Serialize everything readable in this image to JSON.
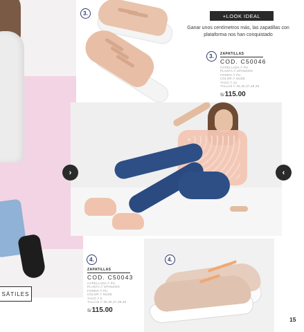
{
  "header": {
    "tag": "+LOOK IDEAL",
    "intro": "Ganar unos centímetros más, las zapatillas con plataforma nos han conquistado"
  },
  "left_label": "SÁTILES",
  "badges": {
    "shoe3_photo": "3.",
    "shoe3_info": "3.",
    "shoe4_photo": "4.",
    "shoe4_info": "4."
  },
  "nav": {
    "next_icon": "›",
    "prev_icon": "‹"
  },
  "products": [
    {
      "category": "ZAPATILLAS",
      "code": "COD. C50046",
      "specs": [
        "CAPELLADA // PU",
        "PLANTA // SPANDON",
        "FORRO // PU",
        "COLOR // NUDE",
        "TACO // 10",
        "TALLAS // 35,36,37,38,39"
      ],
      "currency": "S/",
      "price": "115.00"
    },
    {
      "category": "ZAPATILLAS",
      "code": "COD. C50043",
      "specs": [
        "CAPELLADA // PU",
        "PLANTA // SPANDON",
        "FORRO // PU",
        "COLOR // NUDE",
        "TACO // 6",
        "TALLAS // 35,36,37,38,39"
      ],
      "currency": "S/",
      "price": "115.00"
    }
  ],
  "page_number": "15",
  "colors": {
    "accent": "#2d3a6e",
    "dark": "#2a2a2a",
    "pink": "#f3d4e4",
    "nude": "#e8bfa6"
  },
  "icons": {
    "next": "chevron-right-icon",
    "prev": "chevron-left-icon"
  }
}
